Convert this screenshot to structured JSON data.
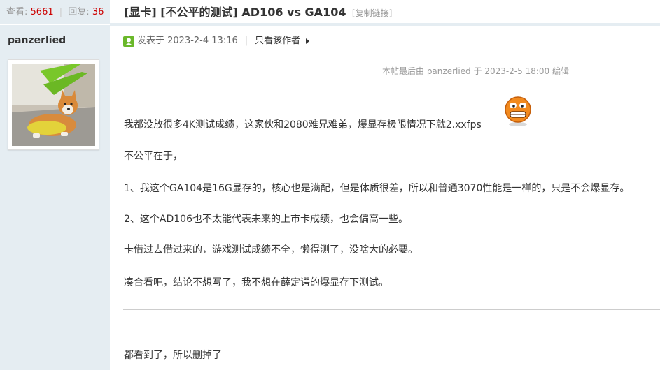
{
  "sidebar": {
    "views_label": "查看:",
    "views_count": "5661",
    "replies_label": "回复:",
    "replies_count": "36",
    "username": "panzerlied",
    "avatar_icon": "corgi-avatar"
  },
  "thread": {
    "title": "[显卡] [不公平的测试] AD106 vs GA104",
    "copy_link": "[复制链接]"
  },
  "post": {
    "online_icon": "user-online-icon",
    "posted_at": "发表于 2023-2-4 13:16",
    "author_only": "只看该作者",
    "edited_note": "本帖最后由 panzerlied 于 2023-2-5 18:00 编辑",
    "paragraphs": [
      "我都没放很多4K测试成绩，这家伙和2080难兄难弟，爆显存极限情况下就2.xxfps",
      "不公平在于，",
      "1、我这个GA104是16G显存的，核心也是满配，但是体质很差，所以和普通3070性能是一样的，只是不会爆显存。",
      "2、这个AD106也不太能代表未来的上市卡成绩，也会偏高一些。",
      "卡借过去借过来的，游戏测试成绩不全，懒得测了，没啥大的必要。",
      "凑合看吧，结论不想写了，我不想在薛定谔的爆显存下测试。"
    ],
    "emoji_icon": "frustrated-face-emoji",
    "footer_text": "都看到了，所以删掉了"
  },
  "colors": {
    "sidebar_bg": "#e5edf2",
    "count_red": "#cc0000",
    "muted": "#999999"
  }
}
